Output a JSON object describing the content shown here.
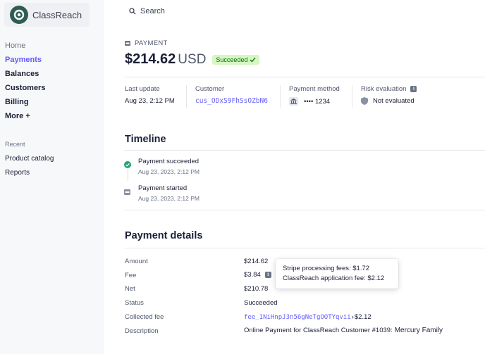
{
  "brand": {
    "name": "ClassReach"
  },
  "search": {
    "label": "Search",
    "icon": "search-icon"
  },
  "nav": [
    {
      "label": "Home"
    },
    {
      "label": "Payments"
    },
    {
      "label": "Balances"
    },
    {
      "label": "Customers"
    },
    {
      "label": "Billing"
    },
    {
      "label": "More +"
    }
  ],
  "recent": {
    "title": "Recent",
    "items": [
      {
        "label": "Product catalog"
      },
      {
        "label": "Reports"
      }
    ]
  },
  "payment": {
    "label": "PAYMENT",
    "amount": "$214.62",
    "currency": "USD",
    "status": "Succeeded",
    "status_color": "#d7f7c2"
  },
  "summary": {
    "last_update": {
      "label": "Last update",
      "value": "Aug 23, 2:12 PM"
    },
    "customer": {
      "label": "Customer",
      "value": "cus_ODxS9FhSsOZbN6"
    },
    "method": {
      "label": "Payment method",
      "value": "•••• 1234"
    },
    "risk": {
      "label": "Risk evaluation",
      "value": "Not evaluated"
    }
  },
  "timeline": {
    "title": "Timeline",
    "events": [
      {
        "title": "Payment succeeded",
        "date": "Aug 23, 2023, 2:12 PM"
      },
      {
        "title": "Payment started",
        "date": "Aug 23, 2023, 2:12 PM"
      }
    ]
  },
  "details": {
    "title": "Payment details",
    "amount": {
      "label": "Amount",
      "value": "$214.62"
    },
    "fee": {
      "label": "Fee",
      "value": "$3.84"
    },
    "net": {
      "label": "Net",
      "value": "$210.78"
    },
    "status": {
      "label": "Status",
      "value": "Succeeded"
    },
    "collected_fee": {
      "label": "Collected fee",
      "link": "fee_1NiHnpJ3n56gNeTgOOTYqvii",
      "arrow": "›",
      "value": "$2.12"
    },
    "description": {
      "label": "Description",
      "value": "Online Payment for ClassReach Customer #1039:",
      "bold": "Mercury Family"
    }
  },
  "tooltip": {
    "line1": "Stripe processing fees: $1.72",
    "line2": "ClassReach application fee: $2.12"
  },
  "colors": {
    "accent": "#635bff",
    "success": "#1ea672"
  }
}
